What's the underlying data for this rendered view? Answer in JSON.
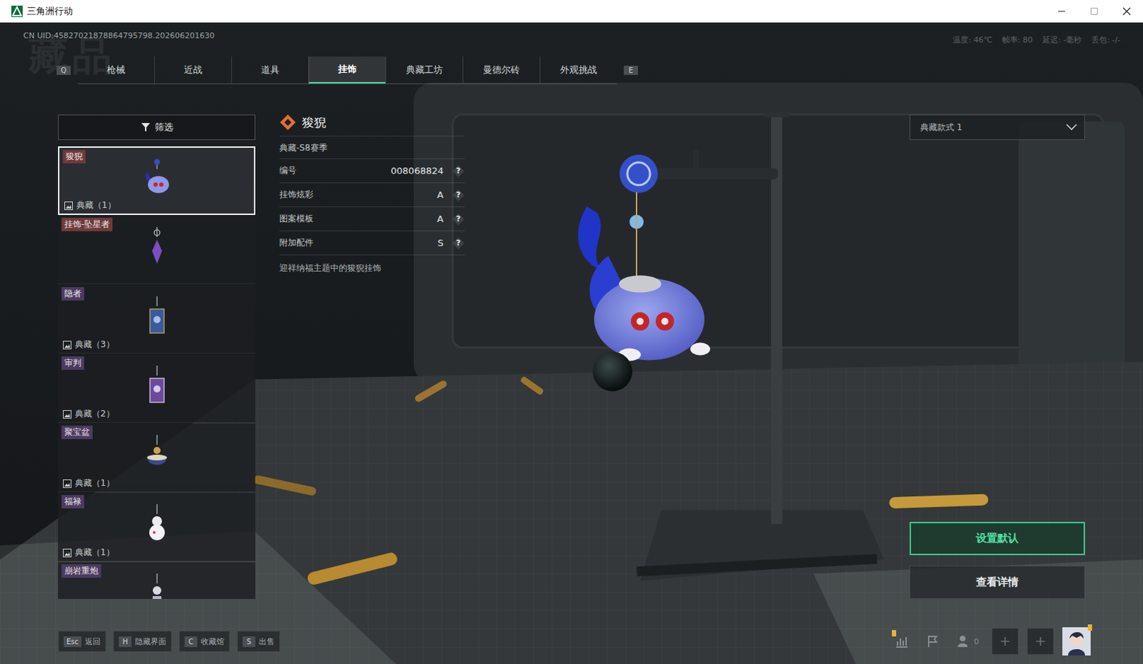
{
  "window": {
    "title": "三角洲行动"
  },
  "header": {
    "uid": "CN UID:45827021878864795798.202606201630",
    "stats": [
      "温度: 46℃",
      "帧率: 80",
      "延迟: -毫秒",
      "丢包: -/-"
    ]
  },
  "watermark": "藏品",
  "tabs": {
    "prev_key": "Q",
    "next_key": "E",
    "items": [
      {
        "label": "枪械",
        "selected": false
      },
      {
        "label": "近战",
        "selected": false
      },
      {
        "label": "道具",
        "selected": false
      },
      {
        "label": "挂饰",
        "selected": true
      },
      {
        "label": "典藏工坊",
        "selected": false
      },
      {
        "label": "曼德尔砖",
        "selected": false
      },
      {
        "label": "外观挑战",
        "selected": false
      }
    ]
  },
  "filter": {
    "label": "筛选"
  },
  "items": [
    {
      "name": "狻猊",
      "count": "典藏（1）",
      "selected": true,
      "kind": "beast",
      "color": "#6e3a3a"
    },
    {
      "name": "挂饰-坠星者",
      "selected": false,
      "kind": "crystal",
      "color": "#6e3a3a"
    },
    {
      "name": "隐者",
      "count": "典藏（3）",
      "selected": false,
      "kind": "card-blue",
      "color": "#4b3b60"
    },
    {
      "name": "审判",
      "count": "典藏（2）",
      "selected": false,
      "kind": "card-purple",
      "color": "#4b3b60"
    },
    {
      "name": "聚宝盆",
      "count": "典藏（1）",
      "selected": false,
      "kind": "bowl",
      "color": "#4b3b60"
    },
    {
      "name": "福禄",
      "count": "典藏（1）",
      "selected": false,
      "kind": "gourd",
      "color": "#4b3b60"
    },
    {
      "name": "崩岩重炮",
      "selected": false,
      "kind": "figure",
      "color": "#4b3b60"
    }
  ],
  "detail": {
    "title": "狻猊",
    "subtitle": "典藏-S8赛季",
    "rows": [
      {
        "label": "编号",
        "value": "008068824",
        "help": "?"
      },
      {
        "label": "挂饰炫彩",
        "value": "A",
        "help": "?"
      },
      {
        "label": "图案模板",
        "value": "A",
        "help": "?"
      },
      {
        "label": "附加配件",
        "value": "S",
        "help": "?"
      }
    ],
    "description": "迎祥纳福主题中的狻猊挂饰"
  },
  "variant_select": {
    "value": "典藏款式 1"
  },
  "actions": [
    {
      "label": "设置默认",
      "highlighted": true
    },
    {
      "label": "查看详情",
      "highlighted": false
    }
  ],
  "shortcuts": [
    {
      "key": "Esc",
      "label": "返回"
    },
    {
      "key": "H",
      "label": "隐藏界面"
    },
    {
      "key": "C",
      "label": "收藏馆"
    },
    {
      "key": "S",
      "label": "出售"
    }
  ],
  "social": {
    "friends_count": "0"
  }
}
